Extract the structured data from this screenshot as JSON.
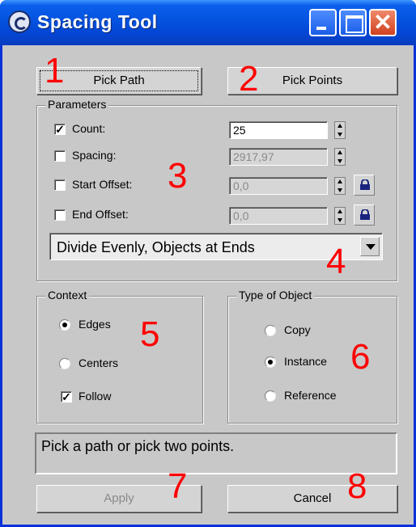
{
  "window": {
    "title": "Spacing Tool"
  },
  "buttons": {
    "pick_path": "Pick Path",
    "pick_points": "Pick Points",
    "apply": "Apply",
    "cancel": "Cancel"
  },
  "parameters": {
    "label": "Parameters",
    "count": {
      "label": "Count:",
      "checked": true,
      "value": "25"
    },
    "spacing": {
      "label": "Spacing:",
      "checked": false,
      "value": "2917,97"
    },
    "start_offset": {
      "label": "Start Offset:",
      "checked": false,
      "value": "0,0"
    },
    "end_offset": {
      "label": "End Offset:",
      "checked": false,
      "value": "0,0"
    },
    "distribution": {
      "selected": "Divide Evenly, Objects at Ends"
    }
  },
  "context": {
    "label": "Context",
    "edges": "Edges",
    "centers": "Centers",
    "follow": "Follow",
    "selected": "Edges",
    "follow_checked": true
  },
  "type_of_object": {
    "label": "Type of Object",
    "copy": "Copy",
    "instance": "Instance",
    "reference": "Reference",
    "selected": "Instance"
  },
  "status": {
    "message": "Pick a path or pick two points."
  },
  "annotations": [
    "1",
    "2",
    "3",
    "4",
    "5",
    "6",
    "7",
    "8"
  ],
  "colors": {
    "annotation": "#ff0000",
    "titlebar": "#0453e0",
    "dialog": "#c8c8c8"
  }
}
